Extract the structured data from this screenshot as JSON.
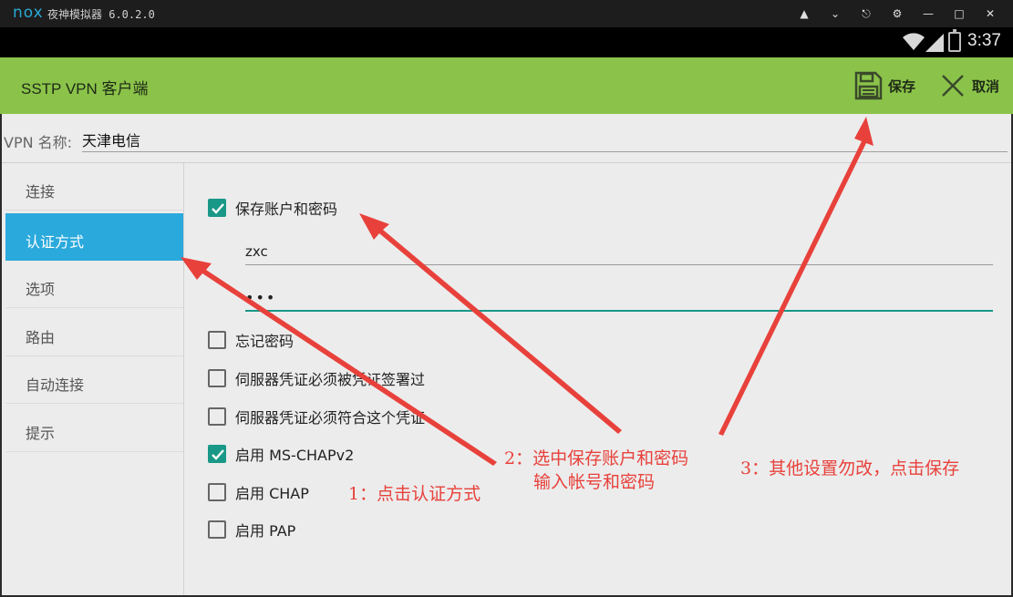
{
  "emulator": {
    "logo": "nox",
    "title": "夜神模拟器 6.0.2.0"
  },
  "status_bar": {
    "time": "3:37"
  },
  "app_bar": {
    "title": "SSTP VPN 客户端",
    "save_label": "保存",
    "cancel_label": "取消"
  },
  "vpn_name": {
    "label": "VPN 名称:",
    "value": "天津电信"
  },
  "sidebar": {
    "items": [
      {
        "label": "连接",
        "active": false
      },
      {
        "label": "认证方式",
        "active": true
      },
      {
        "label": "选项",
        "active": false
      },
      {
        "label": "路由",
        "active": false
      },
      {
        "label": "自动连接",
        "active": false
      },
      {
        "label": "提示",
        "active": false
      }
    ]
  },
  "auth": {
    "save_account": {
      "label": "保存账户和密码",
      "checked": true
    },
    "username": "zxc",
    "password_mask": "•••",
    "options": [
      {
        "label": "忘记密码",
        "checked": false
      },
      {
        "label": "伺服器凭证必须被凭证签署过",
        "checked": false
      },
      {
        "label": "伺服器凭证必须符合这个凭证",
        "checked": false
      },
      {
        "label": "启用 MS-CHAPv2",
        "checked": true
      },
      {
        "label": "启用 CHAP",
        "checked": false
      },
      {
        "label": "启用 PAP",
        "checked": false
      }
    ]
  },
  "annotations": {
    "step1": "1：点击认证方式",
    "step2_line1": "2：选中保存账户和密码",
    "step2_line2": "输入帐号和密码",
    "step3": "3：其他设置勿改，点击保存"
  },
  "colors": {
    "app_bar": "#8bc34a",
    "active_tab": "#2aa9dc",
    "checkbox": "#199888",
    "annotation": "#e8413b"
  }
}
